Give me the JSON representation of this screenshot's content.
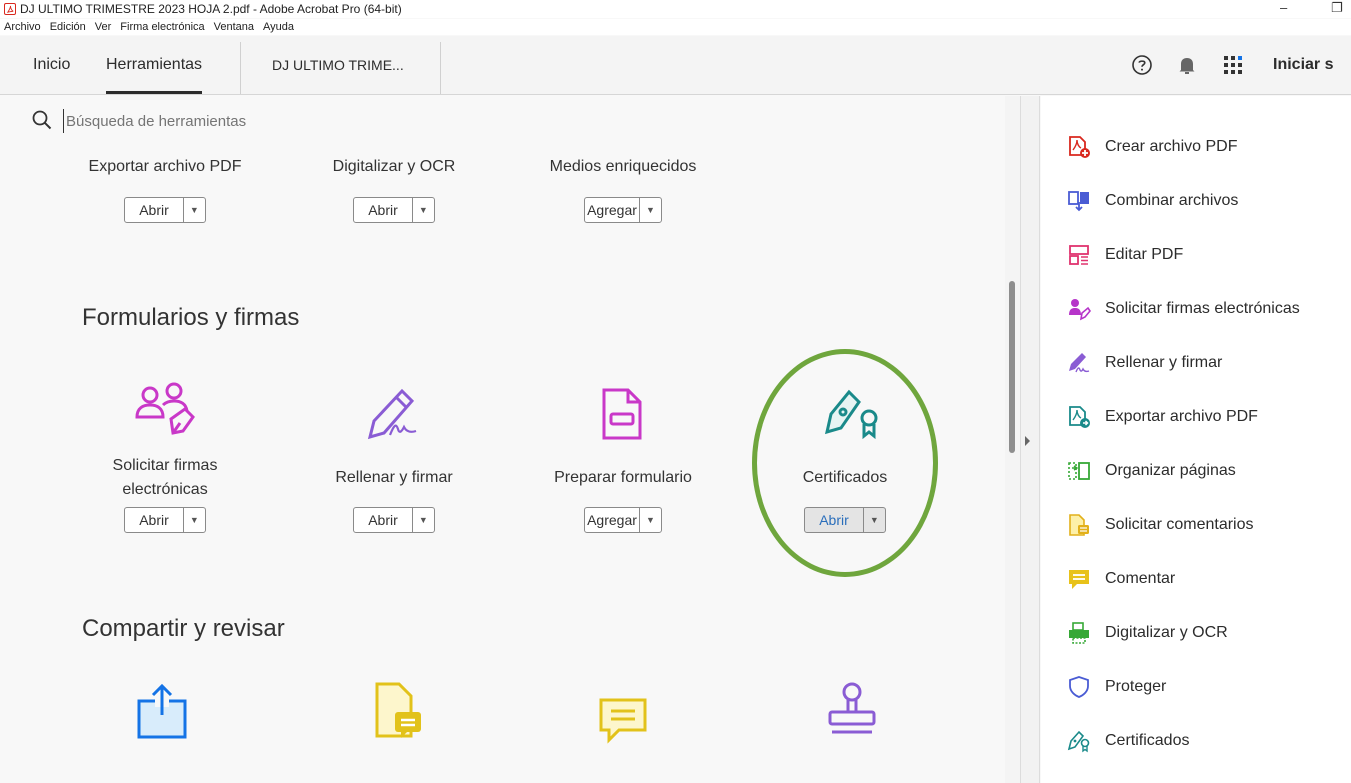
{
  "window": {
    "title": "DJ ULTIMO TRIMESTRE 2023 HOJA 2.pdf - Adobe Acrobat Pro (64-bit)",
    "minimize_glyph": "–",
    "restore_glyph": "❐"
  },
  "menubar": {
    "items": [
      "Archivo",
      "Edición",
      "Ver",
      "Firma electrónica",
      "Ventana",
      "Ayuda"
    ]
  },
  "tabs": {
    "home": "Inicio",
    "tools": "Herramientas",
    "document": "DJ ULTIMO TRIME...",
    "sign_in": "Iniciar s"
  },
  "search": {
    "placeholder": "Búsqueda de herramientas"
  },
  "top_row": [
    {
      "label": "Exportar archivo PDF",
      "button": "Abrir"
    },
    {
      "label": "Digitalizar y OCR",
      "button": "Abrir"
    },
    {
      "label": "Medios enriquecidos",
      "button": "Agregar"
    }
  ],
  "sections": {
    "forms": {
      "heading": "Formularios y firmas",
      "tools": [
        {
          "label_line1": "Solicitar firmas",
          "label_line2": "electrónicas",
          "button": "Abrir",
          "icon": "request-signatures-icon"
        },
        {
          "label": "Rellenar y firmar",
          "button": "Abrir",
          "icon": "fill-sign-icon"
        },
        {
          "label": "Preparar formulario",
          "button": "Agregar",
          "icon": "prepare-form-icon"
        },
        {
          "label": "Certificados",
          "button": "Abrir",
          "icon": "certificates-icon"
        }
      ]
    },
    "share": {
      "heading": "Compartir y revisar"
    }
  },
  "right_pane": {
    "items": [
      {
        "label": "Crear archivo PDF",
        "icon": "create-pdf-icon"
      },
      {
        "label": "Combinar archivos",
        "icon": "combine-files-icon"
      },
      {
        "label": "Editar PDF",
        "icon": "edit-pdf-icon"
      },
      {
        "label": "Solicitar firmas electrónicas",
        "icon": "request-esign-icon"
      },
      {
        "label": "Rellenar y firmar",
        "icon": "fill-sign-icon"
      },
      {
        "label": "Exportar archivo PDF",
        "icon": "export-pdf-icon"
      },
      {
        "label": "Organizar páginas",
        "icon": "organize-pages-icon"
      },
      {
        "label": "Solicitar comentarios",
        "icon": "request-comments-icon"
      },
      {
        "label": "Comentar",
        "icon": "comment-icon"
      },
      {
        "label": "Digitalizar y OCR",
        "icon": "scan-ocr-icon"
      },
      {
        "label": "Proteger",
        "icon": "protect-icon"
      },
      {
        "label": "Certificados",
        "icon": "certificates-icon"
      }
    ]
  },
  "colors": {
    "highlight": "#6fa63d",
    "accent_blue": "#2a6ebb",
    "magenta": "#c938c8",
    "purple": "#8a5cd4",
    "pdf_red": "#d9281e"
  }
}
